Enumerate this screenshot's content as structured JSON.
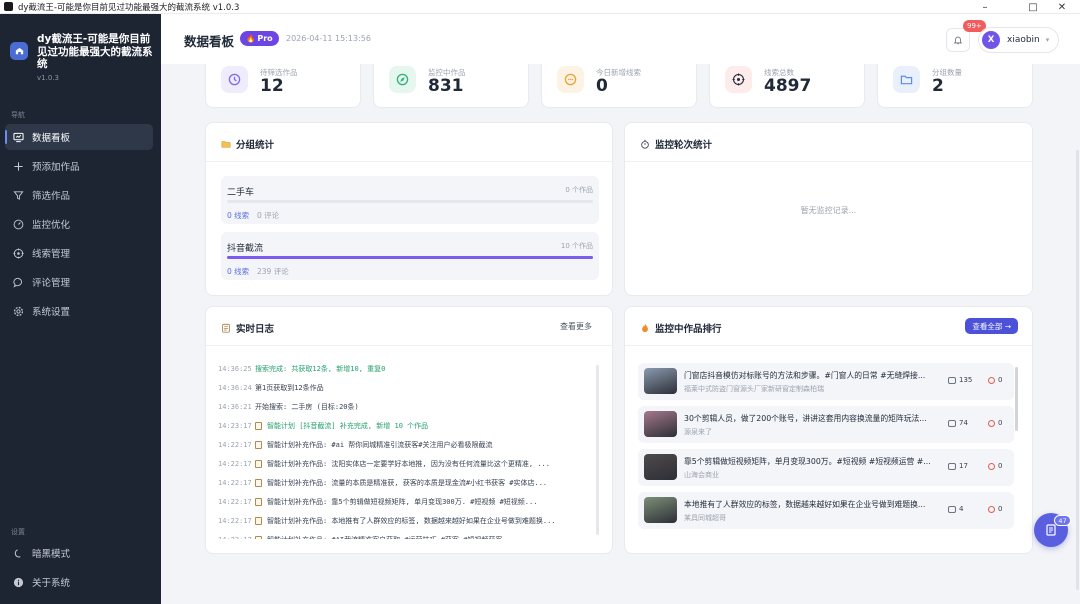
{
  "window": {
    "title": "dy截流王-可能是你目前见过功能最强大的截流系统 v1.0.3",
    "controls": [
      "minimize",
      "maximize",
      "close"
    ]
  },
  "brand": {
    "name": "dy截流王-可能是你目前见过功能最强大的截流系统",
    "version": "v1.0.3"
  },
  "sidebar": {
    "nav_section": "导航",
    "items": [
      {
        "label": "数据看板",
        "icon": "dashboard-icon",
        "active": true
      },
      {
        "label": "预添加作品",
        "icon": "plus-icon",
        "active": false
      },
      {
        "label": "筛选作品",
        "icon": "filter-icon",
        "active": false
      },
      {
        "label": "监控优化",
        "icon": "gauge-icon",
        "active": false
      },
      {
        "label": "线索管理",
        "icon": "target-icon",
        "active": false
      },
      {
        "label": "评论管理",
        "icon": "comment-icon",
        "active": false
      },
      {
        "label": "系统设置",
        "icon": "gear-icon",
        "active": false
      }
    ],
    "settings_section": "设置",
    "settings_items": [
      {
        "label": "暗黑模式",
        "icon": "moon-icon"
      },
      {
        "label": "关于系统",
        "icon": "info-icon"
      }
    ]
  },
  "header": {
    "title": "数据看板",
    "badge": "Pro",
    "datetime": "2026-04-11 15:13:56",
    "notification_count": "99+",
    "user_initial": "X",
    "user_name": "xiaobin"
  },
  "stats": [
    {
      "label": "待筛选作品",
      "value": "12",
      "icon": "clock-icon",
      "color": "#7c6cf0",
      "bg": "#eeecfd"
    },
    {
      "label": "监控中作品",
      "value": "831",
      "icon": "compass-icon",
      "color": "#2fb27a",
      "bg": "#e6f7ef"
    },
    {
      "label": "今日新增线索",
      "value": "0",
      "icon": "chat-icon",
      "color": "#e8a23a",
      "bg": "#fdf3e4"
    },
    {
      "label": "线索总数",
      "value": "4897",
      "icon": "target-icon",
      "color": "#e35d4f",
      "bg": "#fdeceb"
    },
    {
      "label": "分组数量",
      "value": "2",
      "icon": "folder-icon",
      "color": "#5b8de8",
      "bg": "#e9f0fc"
    }
  ],
  "group_stats": {
    "title": "分组统计",
    "groups": [
      {
        "name": "二手车",
        "count": "0 个作品",
        "fill": 0,
        "leads": "0 线索",
        "reviews": "0 评论"
      },
      {
        "name": "抖音截流",
        "count": "10 个作品",
        "fill": 1,
        "leads": "0 线索",
        "reviews": "239 评论"
      }
    ]
  },
  "monitor_rounds": {
    "title": "监控轮次统计",
    "empty": "暂无监控记录..."
  },
  "realtime_log": {
    "title": "实时日志",
    "more": "查看更多",
    "lines": [
      {
        "time": "14:36:25",
        "text": "搜索完成: 共获取12条, 新增10, 重复0",
        "kind": "green",
        "doc": false
      },
      {
        "time": "14:36:24",
        "text": "第1页获取到12条作品",
        "kind": "normal",
        "doc": false
      },
      {
        "time": "14:36:21",
        "text": "开始搜索: 二手房 (目标:20条)",
        "kind": "normal",
        "doc": false
      },
      {
        "time": "14:23:17",
        "text": "智能计划 [抖音截流] 补充完成, 新增 10 个作品",
        "kind": "green",
        "doc": true
      },
      {
        "time": "14:22:17",
        "text": "智能计划补充作品: #ai 帮你同城精准引流获客#关注用户必看极限截流",
        "kind": "normal",
        "doc": true
      },
      {
        "time": "14:22:17",
        "text": "智能计划补充作品: 沈阳实体店一定要学好本地推, 因为没有任何流量比这个更精准, ...",
        "kind": "normal",
        "doc": true
      },
      {
        "time": "14:22:17",
        "text": "智能计划补充作品: 流量的本质是精准获, 获客的本质是现金流#小红书获客 #实体店...",
        "kind": "normal",
        "doc": true
      },
      {
        "time": "14:22:17",
        "text": "智能计划补充作品: 靠5个剪辑做短视频矩阵, 单月变现300万. #短视频 #短视频...",
        "kind": "normal",
        "doc": true
      },
      {
        "time": "14:22:17",
        "text": "智能计划补充作品: 本地推有了人群效应的标签, 数据越来越好如果在企业号做到难题换...",
        "kind": "normal",
        "doc": true
      },
      {
        "time": "14:22:17",
        "text": "智能计划补充作品: #AI截流精准客户获取 #运营技巧 #获客 #短视频获客",
        "kind": "normal",
        "doc": true
      }
    ]
  },
  "ranking": {
    "title": "监控中作品排行",
    "view_all": "查看全部 →",
    "items": [
      {
        "title": "门窗店抖音模仿对标账号的方法和步骤。#门窗人的日常 #无缝焊接...",
        "author": "福莱中式防盗门窗源头厂家新研窗定制森柏瑞",
        "comments": "135",
        "hits": "0",
        "thumb": "#8a9bb0"
      },
      {
        "title": "30个剪辑人员，做了200个账号，讲讲这套用内容换流量的矩阵玩法...",
        "author": "源泉来了",
        "comments": "74",
        "hits": "0",
        "thumb": "#a5788d"
      },
      {
        "title": "靠5个剪辑做短视频矩阵，单月变现300万。#短视频 #短视频运营 #...",
        "author": "山海会商业",
        "comments": "17",
        "hits": "0",
        "thumb": "#4e4a4a"
      },
      {
        "title": "本地推有了人群效应的标签，数据越来越好如果在企业号做到难题换...",
        "author": "某具同城超哥",
        "comments": "4",
        "hits": "0",
        "thumb": "#7d8f78"
      }
    ]
  },
  "fab_badge": "47"
}
